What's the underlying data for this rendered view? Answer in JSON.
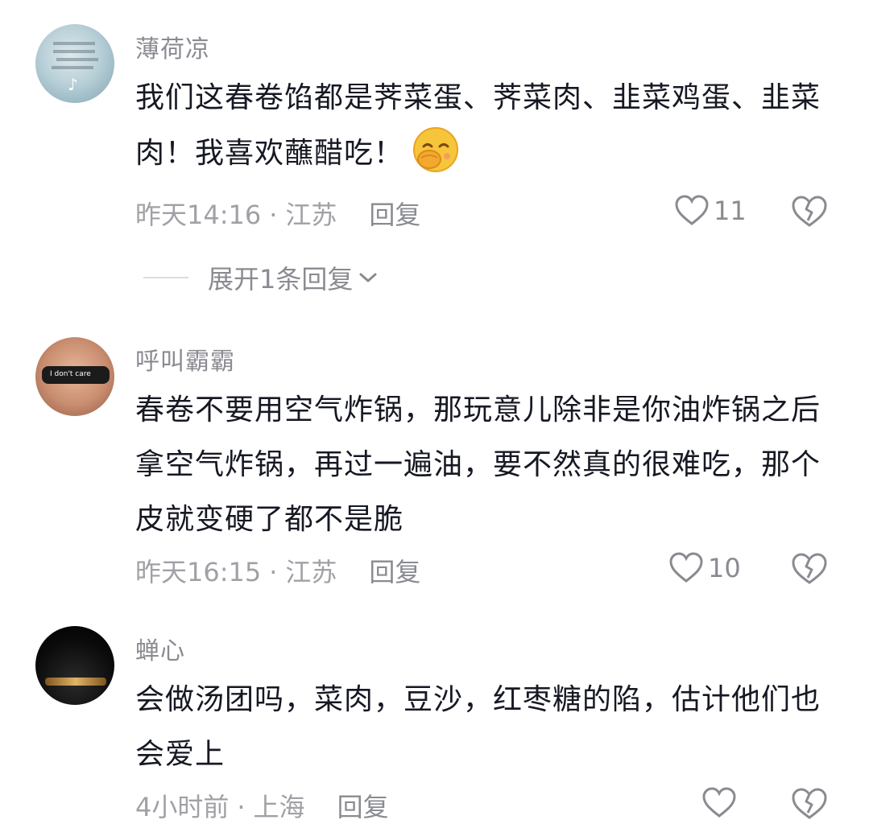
{
  "comments": [
    {
      "author": "薄荷凉",
      "text": "我们这春卷馅都是荠菜蛋、荠菜肉、韭菜鸡蛋、韭菜肉！我喜欢蘸醋吃！",
      "emoji": "face-with-hand-over-mouth",
      "time": "昨天14:16",
      "sep": "·",
      "location": "江苏",
      "reply": "回复",
      "likes": "11",
      "expand_replies": "展开1条回复"
    },
    {
      "author": "呼叫霸霸",
      "avatar_text": "I don't care",
      "text": "春卷不要用空气炸锅，那玩意儿除非是你油炸锅之后拿空气炸锅，再过一遍油，要不然真的很难吃，那个皮就变硬了都不是脆",
      "time": "昨天16:15",
      "sep": "·",
      "location": "江苏",
      "reply": "回复",
      "likes": "10"
    },
    {
      "author": "蝉心",
      "text": "会做汤团吗，菜肉，豆沙，红枣糖的陷，估计他们也会爱上",
      "time": "4小时前",
      "sep": "·",
      "location": "上海",
      "reply": "回复",
      "likes": ""
    }
  ],
  "icons": {
    "like": "heart-outline-icon",
    "dislike": "broken-heart-icon",
    "expand": "chevron-down-icon"
  },
  "colors": {
    "text": "#161823",
    "muted": "#8a8b91",
    "light": "#a0a1a6"
  }
}
